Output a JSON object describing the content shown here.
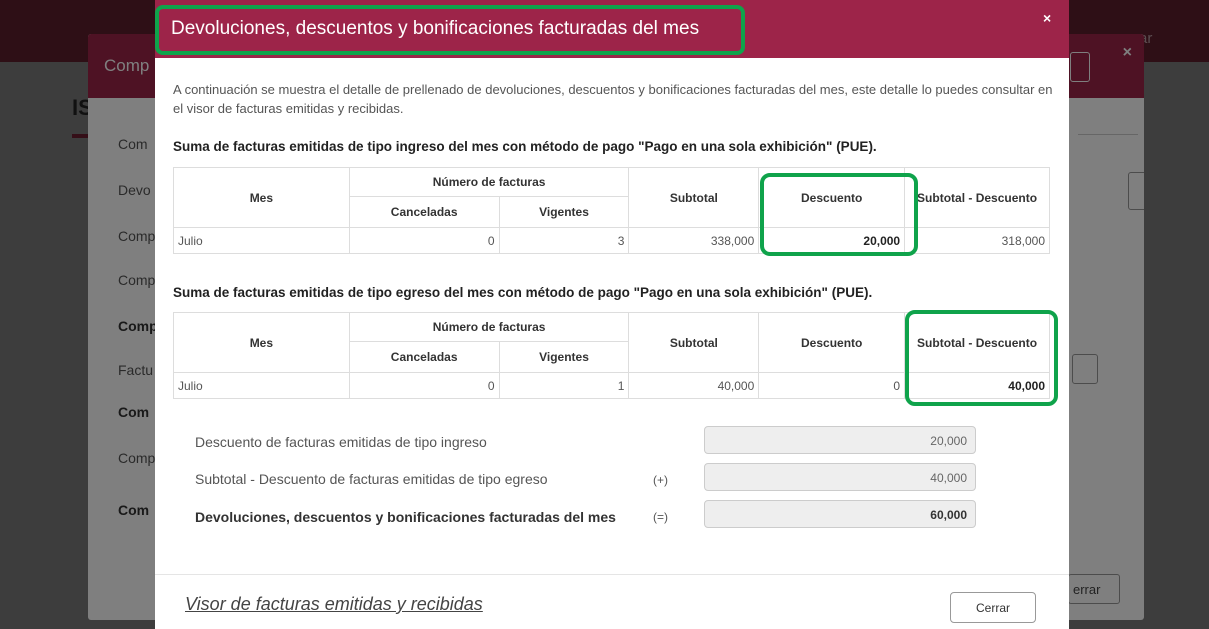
{
  "background": {
    "topbar_cerrar": "rar",
    "page_title": "IS"
  },
  "modal_behind": {
    "title": "Comp",
    "items": [
      {
        "label": "Com",
        "bold": false
      },
      {
        "label": "Devo",
        "bold": false
      },
      {
        "label": "Comp",
        "bold": false
      },
      {
        "label": "Comp",
        "bold": false
      },
      {
        "label": "Comp",
        "bold": true
      },
      {
        "label": "Factu",
        "bold": false
      },
      {
        "label": "Com",
        "bold": true
      },
      {
        "label": "Comp",
        "bold": false
      },
      {
        "label": "Com",
        "bold": true
      }
    ],
    "cerrar": "errar"
  },
  "modal": {
    "title": "Devoluciones, descuentos y bonificaciones facturadas del mes",
    "close": "×",
    "intro": "A continuación se muestra el detalle de prellenado de devoluciones, descuentos y bonificaciones facturadas del mes, este detalle lo puedes consultar en el visor de facturas emitidas y recibidas.",
    "ingreso": {
      "title": "Suma de facturas emitidas de tipo ingreso del mes con método de pago \"Pago en una sola exhibición\" (PUE).",
      "headers": {
        "mes": "Mes",
        "numero": "Número de facturas",
        "canceladas": "Canceladas",
        "vigentes": "Vigentes",
        "subtotal": "Subtotal",
        "descuento": "Descuento",
        "subtotal_descuento": "Subtotal - Descuento"
      },
      "row": {
        "mes": "Julio",
        "canceladas": "0",
        "vigentes": "3",
        "subtotal": "338,000",
        "descuento": "20,000",
        "subtotal_descuento": "318,000"
      }
    },
    "egreso": {
      "title": "Suma de facturas emitidas de tipo egreso del mes con método de pago \"Pago en una sola exhibición\" (PUE).",
      "headers": {
        "mes": "Mes",
        "numero": "Número de facturas",
        "canceladas": "Canceladas",
        "vigentes": "Vigentes",
        "subtotal": "Subtotal",
        "descuento": "Descuento",
        "subtotal_descuento": "Subtotal - Descuento"
      },
      "row": {
        "mes": "Julio",
        "canceladas": "0",
        "vigentes": "1",
        "subtotal": "40,000",
        "descuento": "0",
        "subtotal_descuento": "40,000"
      }
    },
    "summary": [
      {
        "label": "Descuento de facturas emitidas de tipo ingreso",
        "op": "",
        "value": "20,000",
        "bold": false
      },
      {
        "label": "Subtotal - Descuento de facturas emitidas de tipo egreso",
        "op": "(+)",
        "value": "40,000",
        "bold": false
      },
      {
        "label": "Devoluciones, descuentos y bonificaciones facturadas del mes",
        "op": "(=)",
        "value": "60,000",
        "bold": true
      }
    ],
    "footer": {
      "link": "Visor de facturas emitidas y recibidas",
      "button": "Cerrar"
    },
    "highlight_color": "#0fa34b",
    "header_color": "#9d2449"
  }
}
